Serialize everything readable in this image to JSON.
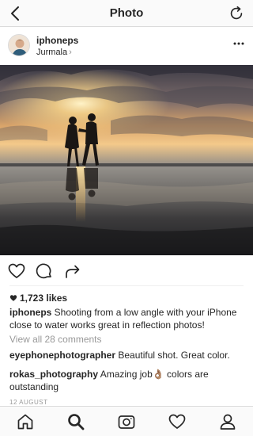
{
  "header": {
    "title": "Photo"
  },
  "post": {
    "username": "iphoneps",
    "location": "Jurmala",
    "location_chevron": "›",
    "likes": "1,723 likes",
    "caption_user": "iphoneps",
    "caption_text": " Shooting from a low angle with your iPhone close to water works great in reflection photos!",
    "view_all": "View all 28 comments",
    "comments": [
      {
        "user": "eyephonephotographer",
        "text": " Beautiful shot. Great color."
      },
      {
        "user": "rokas_photography",
        "text": " Amazing job",
        "emoji": "👌🏽",
        "text_after": " colors are outstanding"
      }
    ],
    "date": "12 AUGUST"
  },
  "icons": {
    "back": "chevron-left-icon",
    "refresh": "refresh-icon",
    "more": "more-dots-icon",
    "like": "heart-icon",
    "comment": "comment-icon",
    "share": "share-icon",
    "home": "home-icon",
    "search": "search-icon",
    "camera": "camera-icon",
    "activity": "heart-icon",
    "profile": "profile-icon"
  },
  "colors": {
    "text": "#262626",
    "muted": "#999999",
    "border": "#dbdbdb"
  }
}
